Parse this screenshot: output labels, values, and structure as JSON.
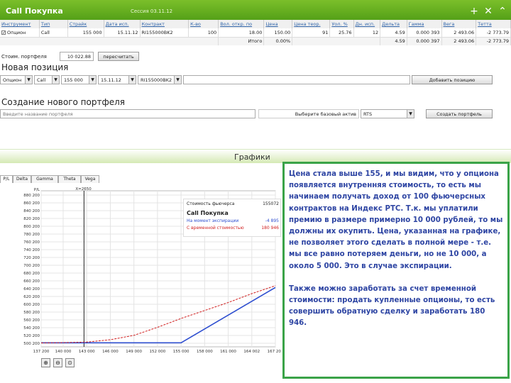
{
  "window": {
    "title": "Call Покупка",
    "session": "Сессия 03.11.12"
  },
  "positions": {
    "headers": [
      "Инструмент",
      "Тип",
      "Страйк",
      "Дата исп.",
      "Контракт",
      "К-во",
      "Вол. откр. по",
      "Цена",
      "Цена теор.",
      "Уол. %",
      "Дн. исп.",
      "Дельта",
      "Гамма",
      "Вега",
      "Тетта"
    ],
    "row": [
      "Опцион",
      "Call",
      "155 000",
      "15.11.12",
      "RI155000BK2",
      "100",
      "18.00",
      "150.00",
      "91",
      "25.76",
      "12",
      "4.59",
      "0.000 393",
      "2 493.06",
      "-2 773.79"
    ],
    "total": {
      "label": "Итого",
      "values": [
        "0.00%",
        "4.59",
        "0.000 397",
        "2 493.06",
        "-2 773.79"
      ]
    }
  },
  "portfolio_sum": {
    "label": "Стоим. портфеля",
    "value": "10 022.88",
    "recalc": "пересчитать"
  },
  "new_position": {
    "title": "Новая позиция",
    "type": "Опцион",
    "kind": "Call",
    "strike": "155 000",
    "date": "15.11.12",
    "contract": "RI155000BK2",
    "add_button": "Добавить позицию"
  },
  "new_portfolio": {
    "title": "Создание нового портфеля",
    "name_placeholder": "Введите название портфеля",
    "base_asset_label": "Выберите базовый актив",
    "base_asset": "RTS",
    "create_button": "Создать портфель"
  },
  "charts_band": {
    "title": "Графики"
  },
  "chart_tabs": [
    "P/L",
    "Delta",
    "Gamma",
    "Theta",
    "Vega"
  ],
  "chart_data": {
    "type": "line",
    "y_axis_label": "P/L",
    "x_marker_label": "X=2650",
    "x": [
      137200,
      140000,
      143000,
      146000,
      149000,
      152000,
      155000,
      158000,
      161000,
      164002,
      167000
    ],
    "x_tick_labels": [
      "137 200",
      "140 000",
      "143 000",
      "146 000",
      "149 000",
      "152 000",
      "155 000",
      "158 000",
      "161 000",
      "164 002",
      "167 200"
    ],
    "y_tick_labels": [
      "880 200",
      "860 200",
      "840 200",
      "820 200",
      "800 200",
      "780 200",
      "760 200",
      "740 200",
      "720 200",
      "700 200",
      "680 200",
      "660 200",
      "640 200",
      "620 200",
      "600 200",
      "580 200",
      "560 200",
      "540 200",
      "520 200",
      "500 200"
    ],
    "ylim": [
      0,
      880200
    ],
    "series": [
      {
        "name": "На момент экспирации",
        "color": "#3050d0",
        "values": [
          [
            137200,
            23000
          ],
          [
            155000,
            23000
          ],
          [
            167000,
            335000
          ]
        ]
      },
      {
        "name": "С временной стоимостью",
        "color": "#d02020",
        "values": [
          [
            137200,
            22000
          ],
          [
            140000,
            24000
          ],
          [
            143000,
            27000
          ],
          [
            146000,
            40000
          ],
          [
            149000,
            65000
          ],
          [
            152000,
            110000
          ],
          [
            155000,
            160000
          ],
          [
            158000,
            205000
          ],
          [
            161000,
            250000
          ],
          [
            164000,
            300000
          ],
          [
            167000,
            345000
          ]
        ]
      }
    ],
    "vertical_marker_x": 142650
  },
  "legend": {
    "futures_label": "Стоимость фьючерса",
    "futures_value": "155072",
    "title": "Call Покупка",
    "expiry_label": "На момент экспирации",
    "expiry_value": "-4 895",
    "time_label": "С временной стоимостью",
    "time_value": "180 946",
    "expiry_color": "#3050d0",
    "time_color": "#d02020"
  },
  "note": {
    "p1": "Цена стала выше 155, и мы видим, что у опциона появляется внутренняя стоимость, то есть мы начинаем получать доход от 100 фьючерсных контрактов на Индекс РТС. Т.к. мы уплатили премию в размере примерно 10 000 рублей, то мы должны их окупить. Цена, указанная на графике, не позволяет этого сделать в полной мере - т.е. мы все равно потеряем деньги, но не 10 000, а около 5 000. Это в случае экспирации.",
    "p2": "Также можно заработать за счет временной стоимости: продать купленные опционы, то есть совершить обратную сделку и заработать 180 946."
  },
  "icons": {
    "zoom_in": "zoom-in-icon",
    "zoom_out": "zoom-out-icon",
    "zoom_reset": "zoom-reset-icon"
  }
}
